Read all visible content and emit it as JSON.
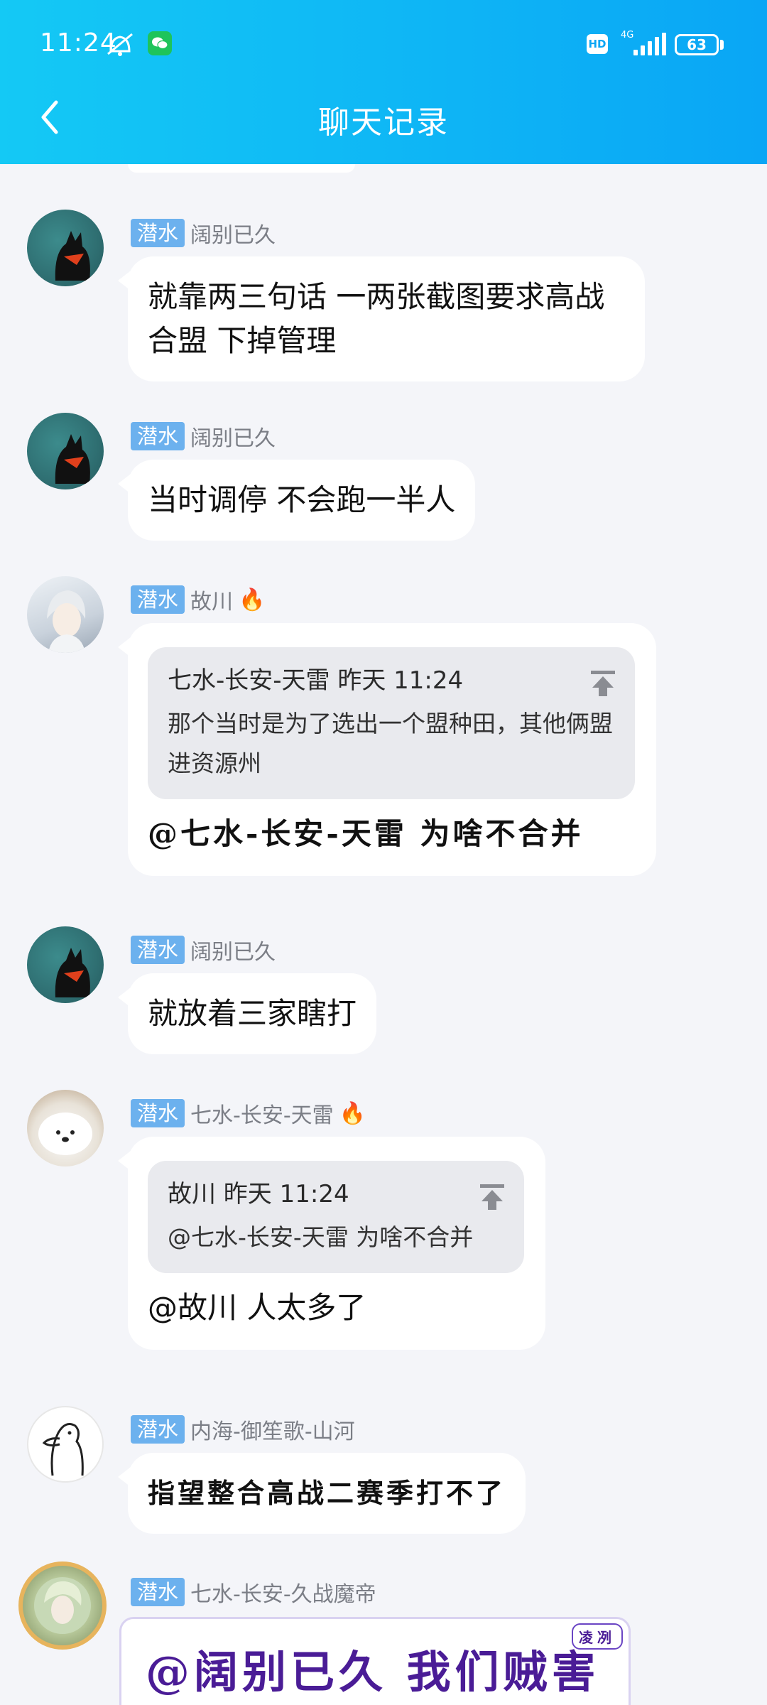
{
  "status_bar": {
    "time": "11:24",
    "hd": "HD",
    "network": "4G",
    "battery": "63"
  },
  "header": {
    "title": "聊天记录"
  },
  "role_label": "潜水",
  "messages": [
    {
      "nick": "阔别已久",
      "text": "就靠两三句话 一两张截图要求高战合盟 下掉管理"
    },
    {
      "nick": "阔别已久",
      "text": "当时调停 不会跑一半人"
    },
    {
      "nick": "故川",
      "flame": "🔥",
      "quote": {
        "head": "七水-长安-天雷 昨天 11:24",
        "text": "那个当时是为了选出一个盟种田，其他俩盟进资源州"
      },
      "text": "@七水-长安-天雷 为啥不合并"
    },
    {
      "nick": "阔别已久",
      "text": "就放着三家瞎打"
    },
    {
      "nick": "七水-长安-天雷",
      "flame": "🔥",
      "quote": {
        "head": "故川 昨天 11:24",
        "text": "@七水-长安-天雷 为啥不合并"
      },
      "text": "@故川 人太多了"
    },
    {
      "nick": "内海-御笙歌-山河",
      "text": "指望整合高战二赛季打不了"
    },
    {
      "nick": "七水-长安-久战魔帝",
      "tag": "凌冽",
      "text": "@阔别已久 我们贼害"
    }
  ]
}
